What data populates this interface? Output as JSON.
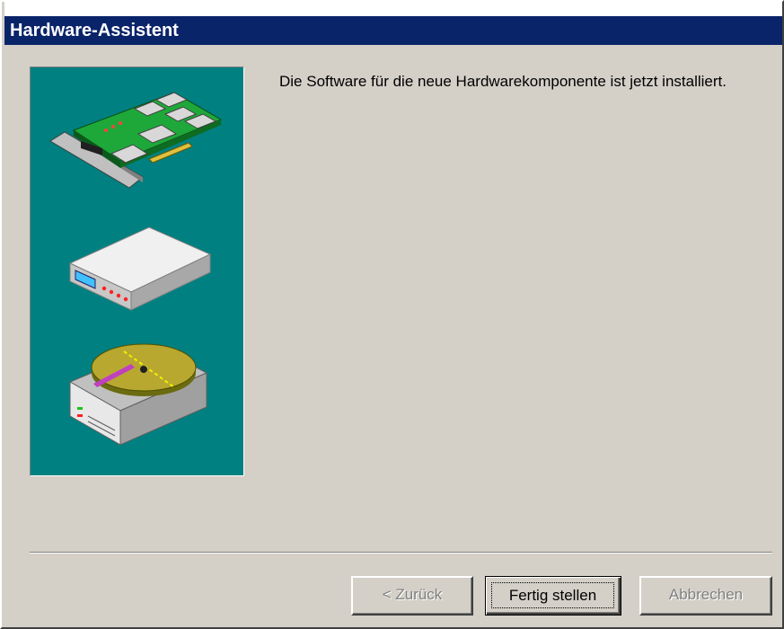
{
  "window": {
    "title": "Hardware-Assistent"
  },
  "main": {
    "message": "Die Software für die neue Hardwarekomponente ist jetzt installiert."
  },
  "buttons": {
    "back_label": "< Zurück",
    "finish_label": "Fertig stellen",
    "cancel_label": "Abbrechen"
  },
  "illustration": {
    "icons": [
      "expansion-card-icon",
      "modem-icon",
      "hard-disk-icon"
    ],
    "background_color": "#008080"
  },
  "colors": {
    "title_bar": "#0a246a",
    "dialog_face": "#d4d0c8",
    "disabled_text": "#808080"
  }
}
